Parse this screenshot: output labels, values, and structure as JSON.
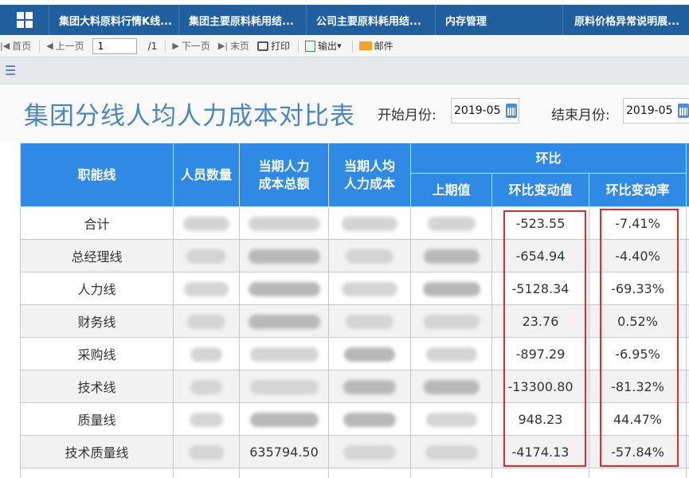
{
  "tabs": [
    "集团大料原料行情K线...",
    "集团主要原料耗用结...",
    "公司主要原料耗用结...",
    "内存管理",
    "原料价格异常说明展..."
  ],
  "toolbar": {
    "first": "首页",
    "prev": "上一页",
    "page_value": "1",
    "page_total": "/1",
    "next": "下一页",
    "last": "末页",
    "print": "打印",
    "export": "输出",
    "mail": "邮件"
  },
  "report": {
    "title": "集团分线人均人力成本对比表",
    "start_label": "开始月份:",
    "start_value": "2019-05",
    "end_label": "结束月份:",
    "end_value": "2019-05"
  },
  "table": {
    "headers": {
      "line": "职能线",
      "headcount": "人员数量",
      "total_cost_1": "当期人力",
      "total_cost_2": "成本总额",
      "per_capita_1": "当期人均",
      "per_capita_2": "人力成本",
      "mom": "环比",
      "prev": "上期值",
      "mom_change": "环比变动值",
      "mom_rate": "环比变动率"
    },
    "rows": [
      {
        "line": "合计",
        "total": "",
        "change": "-523.55",
        "rate": "-7.41%"
      },
      {
        "line": "总经理线",
        "total": "",
        "change": "-654.94",
        "rate": "-4.40%"
      },
      {
        "line": "人力线",
        "total": "",
        "change": "-5128.34",
        "rate": "-69.33%"
      },
      {
        "line": "财务线",
        "total": "",
        "change": "23.76",
        "rate": "0.52%"
      },
      {
        "line": "采购线",
        "total": "",
        "change": "-897.29",
        "rate": "-6.95%"
      },
      {
        "line": "技术线",
        "total": "",
        "change": "-13300.80",
        "rate": "-81.32%"
      },
      {
        "line": "质量线",
        "total": "",
        "change": "948.23",
        "rate": "44.47%"
      },
      {
        "line": "技术质量线",
        "total": "635794.50",
        "change": "-4174.13",
        "rate": "-57.84%"
      }
    ]
  },
  "colors": {
    "tabbar": "#1f5f9e",
    "title": "#4a86c5",
    "header": "#2f8ae5",
    "highlight": "#dd2c2c"
  }
}
